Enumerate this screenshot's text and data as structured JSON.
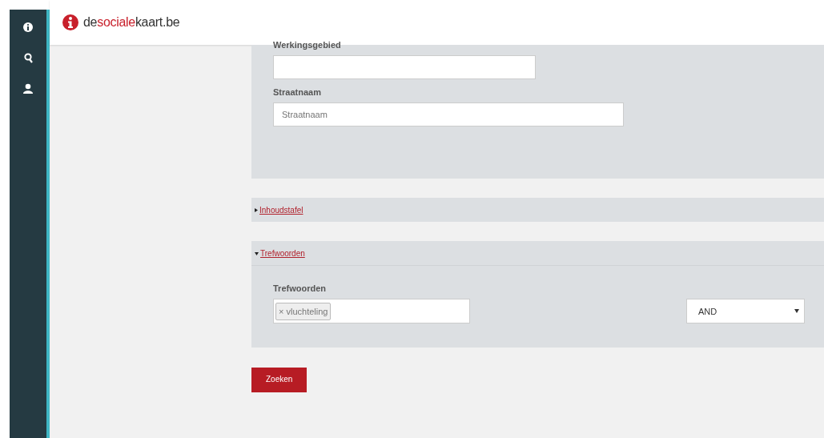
{
  "sidebar": {
    "items": [
      {
        "kind": "info"
      },
      {
        "kind": "search"
      },
      {
        "kind": "user"
      }
    ]
  },
  "header": {
    "logo_parts": [
      {
        "text": "de",
        "color": "#333333"
      },
      {
        "text": "sociale",
        "color": "#c8202b"
      },
      {
        "text": "kaart.be",
        "color": "#333333"
      }
    ]
  },
  "location_panel": {
    "fields": [
      {
        "label": "Werkingsgebied",
        "wide": false
      },
      {
        "label": "Straatnaam",
        "placeholder": "Straatnaam",
        "wide": true
      }
    ]
  },
  "sections": [
    {
      "title": "Inhoudstafel",
      "expanded": false
    },
    {
      "title": "Trefwoorden",
      "expanded": true
    }
  ],
  "keywords": {
    "label": "Trefwoorden",
    "tags": [
      {
        "remove": "×",
        "text": "vluchteling"
      }
    ],
    "operator": "AND"
  },
  "search_button": "Zoeken"
}
